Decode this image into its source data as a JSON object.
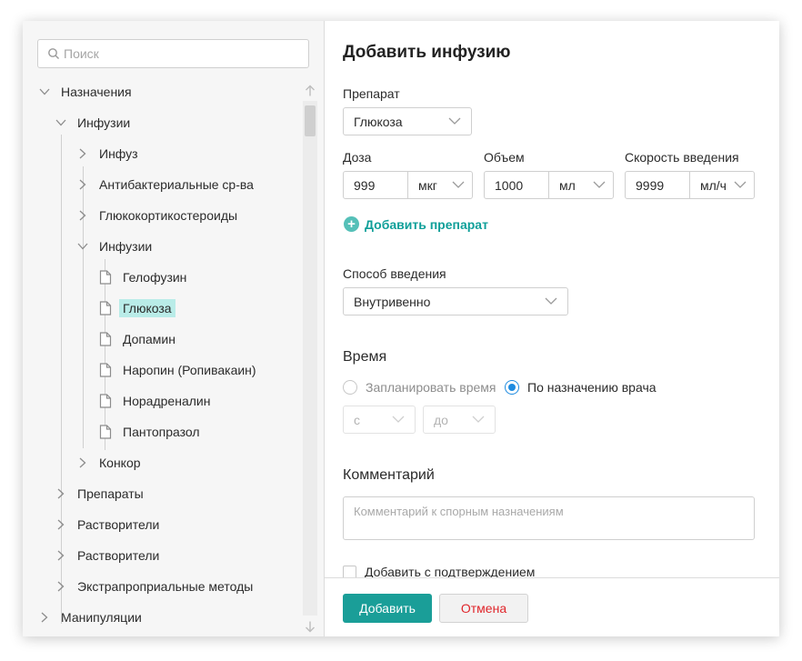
{
  "search": {
    "placeholder": "Поиск"
  },
  "tree": {
    "items": [
      {
        "label": "Назначения"
      },
      {
        "label": "Инфузии"
      },
      {
        "label": "Инфуз"
      },
      {
        "label": "Антибактериальные ср-ва"
      },
      {
        "label": "Глюкокортикостероиды"
      },
      {
        "label": "Инфузии"
      },
      {
        "label": "Гелофузин"
      },
      {
        "label": "Глюкоза"
      },
      {
        "label": "Допамин"
      },
      {
        "label": "Наропин (Ропивакаин)"
      },
      {
        "label": "Норадреналин"
      },
      {
        "label": "Пантопразол"
      },
      {
        "label": "Конкор"
      },
      {
        "label": "Препараты"
      },
      {
        "label": "Растворители"
      },
      {
        "label": "Растворители"
      },
      {
        "label": "Экстрапроприальные методы"
      },
      {
        "label": "Манипуляции"
      }
    ]
  },
  "form": {
    "title": "Добавить инфузию",
    "drug_label": "Препарат",
    "drug_value": "Глюкоза",
    "dose_label": "Доза",
    "dose_value": "999",
    "dose_unit": "мкг",
    "volume_label": "Объем",
    "volume_value": "1000",
    "volume_unit": "мл",
    "rate_label": "Скорость введения",
    "rate_value": "9999",
    "rate_unit": "мл/ч",
    "add_drug": "Добавить препарат",
    "route_label": "Способ введения",
    "route_value": "Внутривенно",
    "time_label": "Время",
    "radio_schedule": "Запланировать время",
    "radio_doctor": "По назначению врача",
    "from_placeholder": "с",
    "to_placeholder": "до",
    "comment_label": "Комментарий",
    "comment_placeholder": "Комментарий к спорным назначениям",
    "confirm_label": "Добавить с подтверждением",
    "submit": "Добавить",
    "cancel": "Отмена"
  },
  "colors": {
    "accent": "#1a9e98",
    "selected_bg": "#b9ece8",
    "cancel_text": "#e0262b",
    "radio_on": "#1e8be0"
  }
}
